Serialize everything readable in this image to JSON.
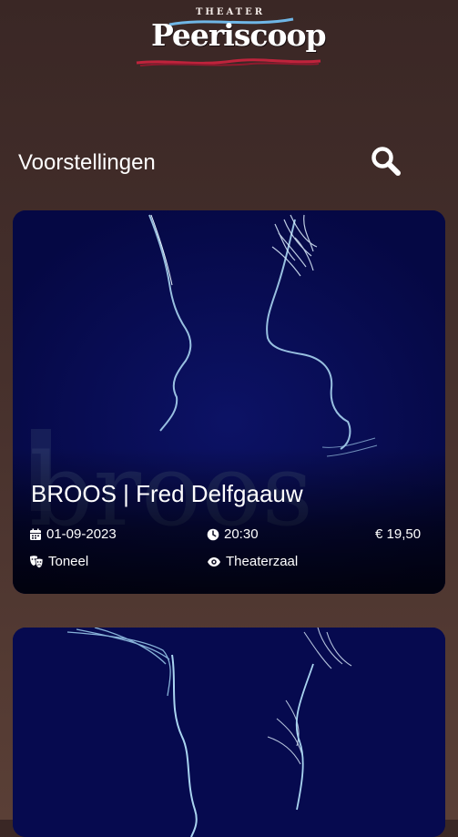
{
  "header": {
    "logo_small": "THEATER",
    "logo_main": "Peeriscoop"
  },
  "page": {
    "section_title": "Voorstellingen"
  },
  "icons": {
    "search": "search-icon",
    "date": "calendar-icon",
    "time": "clock-icon",
    "genre": "theater-masks-icon",
    "venue": "eye-icon"
  },
  "colors": {
    "background": "#46302c",
    "card": "#070a4e",
    "text": "#ffffff",
    "logo_accent": "#c0233c"
  },
  "shows": [
    {
      "title": "BROOS | Fred Delfgaauw",
      "date": "01-09-2023",
      "time": "20:30",
      "price": "€ 19,50",
      "genre": "Toneel",
      "venue": "Theaterzaal"
    }
  ]
}
